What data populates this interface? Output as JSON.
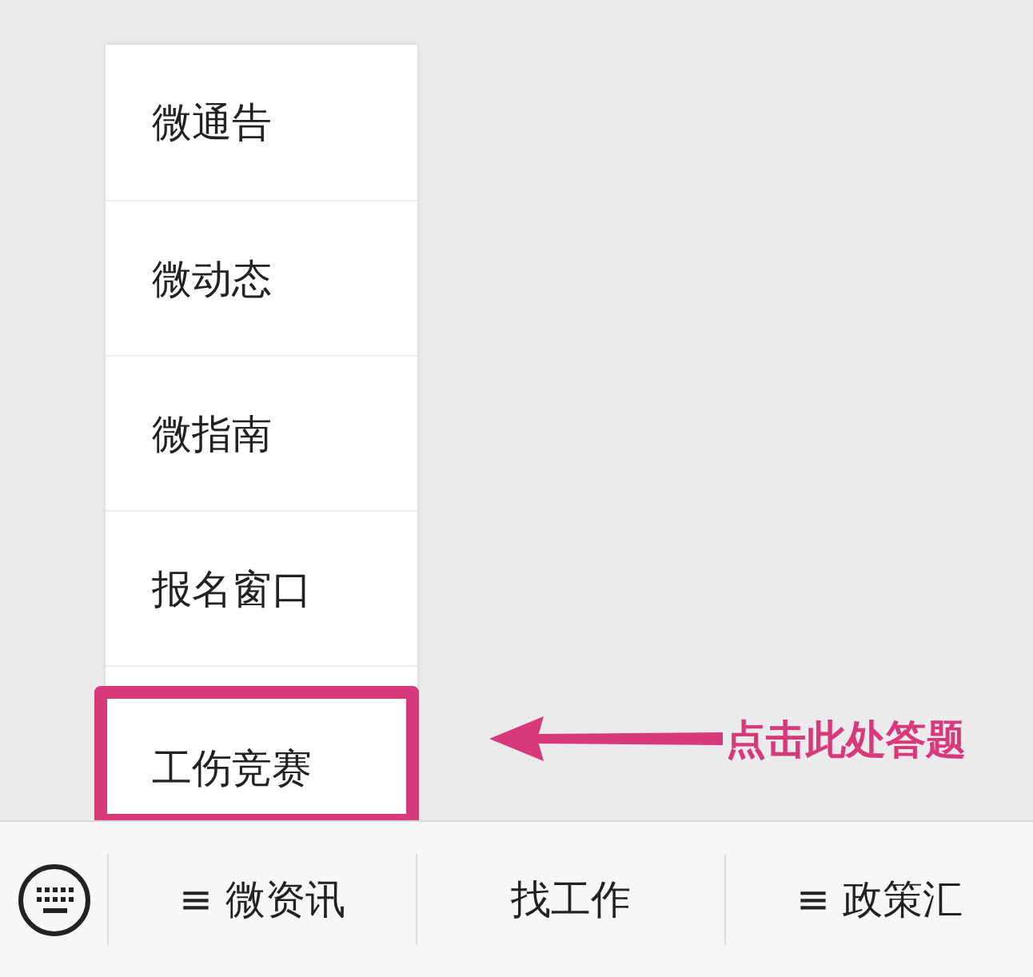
{
  "menu": {
    "items": [
      {
        "label": "微通告",
        "highlighted": false
      },
      {
        "label": "微动态",
        "highlighted": false
      },
      {
        "label": "微指南",
        "highlighted": false
      },
      {
        "label": "报名窗口",
        "highlighted": false
      },
      {
        "label": "工伤竞赛",
        "highlighted": true
      }
    ]
  },
  "annotation": {
    "text": "点击此处答题"
  },
  "bottom_bar": {
    "items": [
      {
        "label": "≡ 微资讯"
      },
      {
        "label": "找工作"
      },
      {
        "label": "≡ 政策汇"
      }
    ]
  }
}
